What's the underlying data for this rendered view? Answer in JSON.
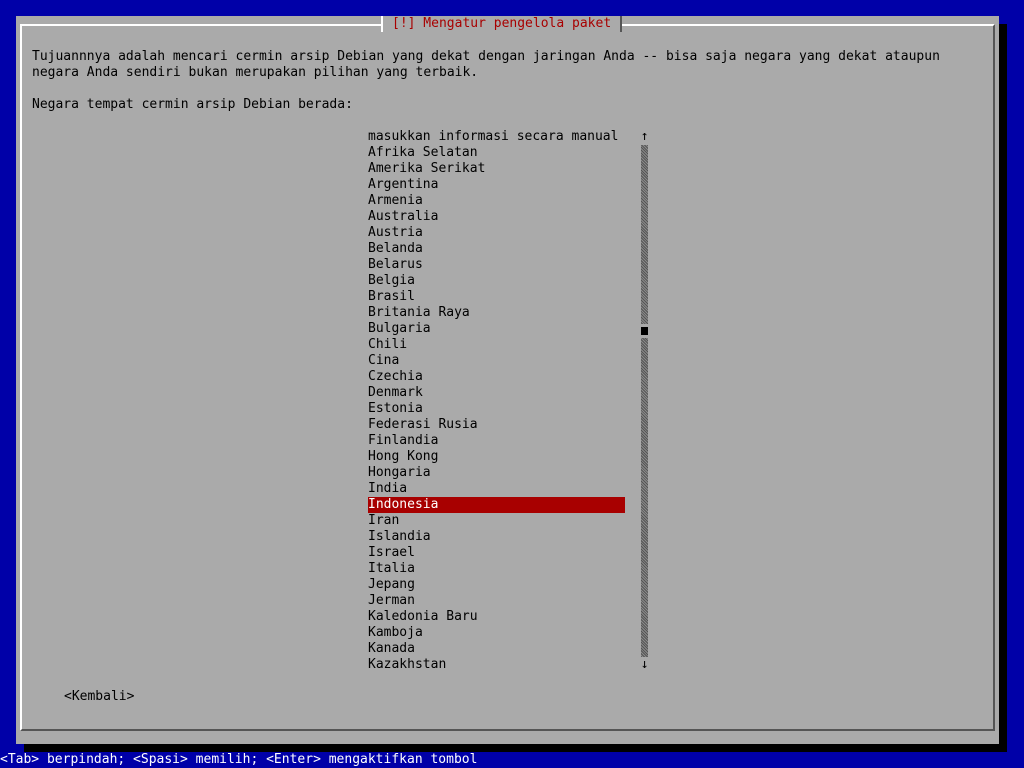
{
  "dialog": {
    "title": "[!] Mengatur pengelola paket",
    "description_line1": "Tujuannnya adalah mencari cermin arsip Debian yang dekat dengan jaringan Anda -- bisa saja negara yang dekat ataupun",
    "description_line2": "negara Anda sendiri bukan merupakan pilihan yang terbaik.",
    "prompt": "Negara tempat cermin arsip Debian berada:",
    "back_button": "<Kembali>"
  },
  "country_list": {
    "selected": "Indonesia",
    "items": [
      "masukkan informasi secara manual",
      "Afrika Selatan",
      "Amerika Serikat",
      "Argentina",
      "Armenia",
      "Australia",
      "Austria",
      "Belanda",
      "Belarus",
      "Belgia",
      "Brasil",
      "Britania Raya",
      "Bulgaria",
      "Chili",
      "Cina",
      "Czechia",
      "Denmark",
      "Estonia",
      "Federasi Rusia",
      "Finlandia",
      "Hong Kong",
      "Hongaria",
      "India",
      "Indonesia",
      "Iran",
      "Islandia",
      "Israel",
      "Italia",
      "Jepang",
      "Jerman",
      "Kaledonia Baru",
      "Kamboja",
      "Kanada",
      "Kazakhstan"
    ]
  },
  "scrollbar": {
    "up_arrow": "↑",
    "down_arrow": "↓"
  },
  "status_bar": {
    "text": "<Tab> berpindah; <Spasi> memilih; <Enter> mengaktifkan tombol"
  },
  "colors": {
    "background": "#0000a8",
    "dialog": "#aaaaaa",
    "title_text": "#a80000",
    "selection": "#a80000",
    "selection_text": "#ffffff"
  }
}
